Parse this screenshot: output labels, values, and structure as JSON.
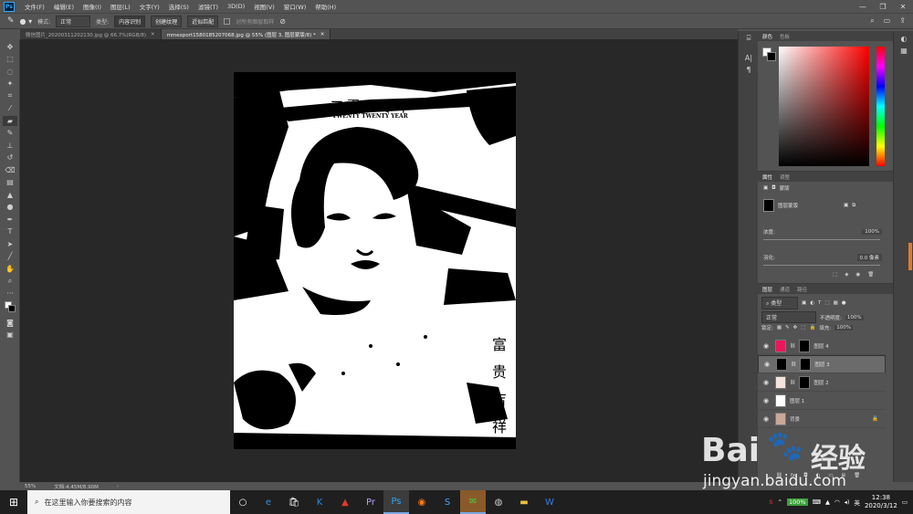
{
  "menubar": {
    "logo": "Ps",
    "items": [
      "文件(F)",
      "编辑(E)",
      "图像(I)",
      "图层(L)",
      "文字(Y)",
      "选择(S)",
      "滤镜(T)",
      "3D(D)",
      "视图(V)",
      "窗口(W)",
      "帮助(H)"
    ]
  },
  "options": {
    "mode_label": "模式:",
    "mode_value": "正常",
    "type_label": "类型:",
    "type_buttons": [
      "内容识别",
      "创建纹理",
      "近似匹配"
    ],
    "sample_all": "对所有图层取样"
  },
  "tabs": [
    {
      "label": "微信图片_20200311202130.jpg @ 66.7%(RGB/8)"
    },
    {
      "label": "mmexport1580185207068.jpg @ 55% (图层 3, 图层蒙版/8) *"
    }
  ],
  "canvas": {
    "poster_title_cn": "二零二零年",
    "poster_title_en": "TWENTY TWENTY YEAR",
    "vertical_text": [
      "富",
      "贵",
      "吉",
      "祥"
    ]
  },
  "status": {
    "zoom": "55%",
    "doc": "文档:4.45M/8.90M"
  },
  "color_panel": {
    "tabs": [
      "颜色",
      "色板"
    ]
  },
  "properties": {
    "tabs": [
      "属性",
      "调整"
    ],
    "mask_label": "蒙版",
    "layer_mask_label": "图层蒙版",
    "density_label": "浓度:",
    "density_value": "100%",
    "feather_label": "羽化:",
    "feather_value": "0.0 像素"
  },
  "layers_panel": {
    "tabs": [
      "图层",
      "通道",
      "路径"
    ],
    "filter_label": "类型",
    "blend_mode": "正常",
    "opacity_label": "不透明度:",
    "opacity_value": "100%",
    "lock_label": "锁定:",
    "fill_label": "填充:",
    "fill_value": "100%",
    "layers": [
      {
        "name": "图层 4",
        "color": "#e8185a",
        "selected": false,
        "mask": true
      },
      {
        "name": "图层 3",
        "color": "#000000",
        "selected": true,
        "mask": true
      },
      {
        "name": "图层 2",
        "color": "#f4e4dc",
        "selected": false,
        "mask": true
      },
      {
        "name": "图层 1",
        "color": "#ffffff",
        "selected": false,
        "mask": false
      },
      {
        "name": "背景",
        "color": "#c8a89a",
        "selected": false,
        "mask": false
      }
    ]
  },
  "taskbar": {
    "search_placeholder": "在这里输入你要搜索的内容",
    "battery": "100%",
    "time": "12:38",
    "date": "2020/3/12"
  },
  "watermark": {
    "brand": "Bai",
    "brand_cn": "经验",
    "url": "jingyan.baidu.com"
  }
}
